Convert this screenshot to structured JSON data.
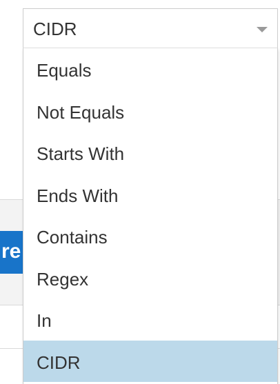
{
  "background": {
    "button_fragment": "re",
    "button_color": "#1874c9"
  },
  "select": {
    "value": "CIDR",
    "icon": "chevron-down-icon"
  },
  "menu": {
    "options": [
      {
        "label": "Equals",
        "selected": false
      },
      {
        "label": "Not Equals",
        "selected": false
      },
      {
        "label": "Starts With",
        "selected": false
      },
      {
        "label": "Ends With",
        "selected": false
      },
      {
        "label": "Contains",
        "selected": false
      },
      {
        "label": "Regex",
        "selected": false
      },
      {
        "label": "In",
        "selected": false
      },
      {
        "label": "CIDR",
        "selected": true
      }
    ],
    "selected_color": "#bcd9ea"
  }
}
